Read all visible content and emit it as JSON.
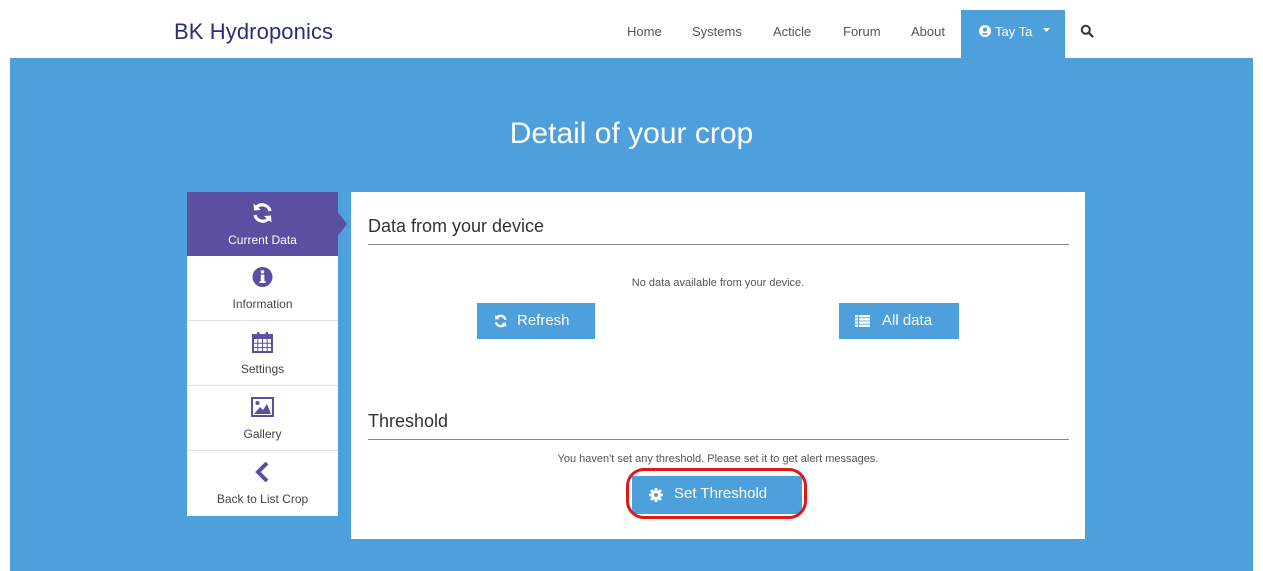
{
  "brand": "BK Hydroponics",
  "nav": {
    "links": [
      "Home",
      "Systems",
      "Acticle",
      "Forum",
      "About"
    ],
    "user": "Tay Ta"
  },
  "page_title": "Detail of your crop",
  "sidebar": {
    "items": [
      {
        "label": "Current Data",
        "icon": "refresh-icon",
        "active": true
      },
      {
        "label": "Information",
        "icon": "info-icon",
        "active": false
      },
      {
        "label": "Settings",
        "icon": "calendar-icon",
        "active": false
      },
      {
        "label": "Gallery",
        "icon": "image-icon",
        "active": false
      },
      {
        "label": "Back to List Crop",
        "icon": "chevron-left-icon",
        "active": false
      }
    ]
  },
  "device": {
    "title": "Data from your device",
    "message": "No data available from your device.",
    "refresh_label": "Refresh",
    "all_data_label": "All data"
  },
  "threshold": {
    "title": "Threshold",
    "message": "You haven't set any threshold. Please set it to get alert messages.",
    "button_label": "Set Threshold"
  },
  "colors": {
    "brand": "#2b2d7c",
    "primary": "#4ea0dc",
    "sidebar_active": "#5a50a2",
    "highlight": "#e01818"
  }
}
